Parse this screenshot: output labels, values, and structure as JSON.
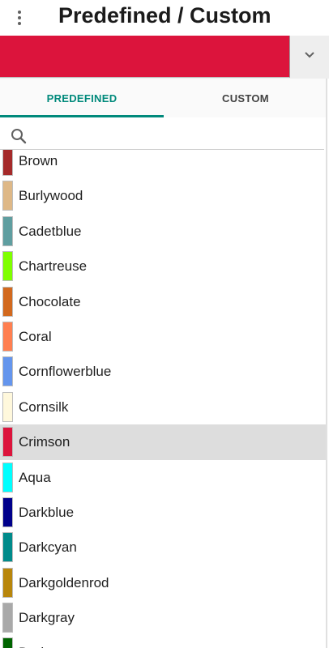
{
  "header": {
    "title": "Predefined / Custom"
  },
  "current_color": {
    "hex": "#DC143C"
  },
  "tabs": [
    {
      "label": "PREDEFINED",
      "active": true
    },
    {
      "label": "CUSTOM",
      "active": false
    }
  ],
  "search": {
    "value": "",
    "placeholder": ""
  },
  "colors": [
    {
      "name": "Brown",
      "hex": "#A52A2A"
    },
    {
      "name": "Burlywood",
      "hex": "#DEB887"
    },
    {
      "name": "Cadetblue",
      "hex": "#5F9EA0"
    },
    {
      "name": "Chartreuse",
      "hex": "#7FFF00"
    },
    {
      "name": "Chocolate",
      "hex": "#D2691E"
    },
    {
      "name": "Coral",
      "hex": "#FF7F50"
    },
    {
      "name": "Cornflowerblue",
      "hex": "#6495ED"
    },
    {
      "name": "Cornsilk",
      "hex": "#FFF8DC"
    },
    {
      "name": "Crimson",
      "hex": "#DC143C",
      "selected": true
    },
    {
      "name": "Aqua",
      "hex": "#00FFFF"
    },
    {
      "name": "Darkblue",
      "hex": "#00008B"
    },
    {
      "name": "Darkcyan",
      "hex": "#008B8B"
    },
    {
      "name": "Darkgoldenrod",
      "hex": "#B8860B"
    },
    {
      "name": "Darkgray",
      "hex": "#A9A9A9"
    },
    {
      "name": "Darkgreen",
      "hex": "#006400"
    }
  ],
  "icons": {
    "menu": "more-vert-icon",
    "dropdown": "chevron-down-icon",
    "search": "search-icon"
  }
}
